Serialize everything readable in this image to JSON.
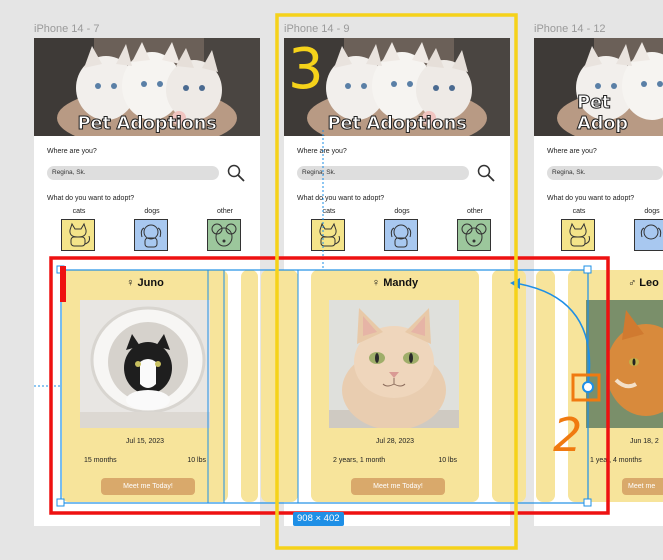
{
  "frames": [
    {
      "label": "iPhone 14 - 7"
    },
    {
      "label": "iPhone 14 - 9"
    },
    {
      "label": "iPhone 14 - 12"
    }
  ],
  "app": {
    "title": "Pet Adoptions",
    "title_short": "Pet Adop",
    "location_question": "Where are you?",
    "location_value": "Regina, Sk.",
    "adopt_question": "What do you want to adopt?",
    "categories": [
      "cats",
      "dogs",
      "other"
    ],
    "category_short": "dogs"
  },
  "cards": [
    {
      "name": "♀ Juno",
      "date": "Jul 15, 2023",
      "age": "15 months",
      "weight": "10 lbs",
      "button": "Meet me Today!"
    },
    {
      "name": "♀ Mandy",
      "date": "Jul 28, 2023",
      "age": "2 years, 1 month",
      "weight": "10 lbs",
      "button": "Meet me Today!"
    },
    {
      "name": "♂ Leo",
      "date": "Jun 18, 2",
      "age": "1 year, 4 months",
      "weight": "",
      "button": "Meet me"
    }
  ],
  "annotations": {
    "one": "1",
    "two": "2",
    "three": "3",
    "dimension_badge": "908 × 402"
  },
  "colors": {
    "card": "#f7e49b",
    "button": "#d9a96b",
    "cats_box": "#f4e48a",
    "dogs_box": "#a8c8f0",
    "other_box": "#9cc79c",
    "red_annotation": "#ee1111",
    "yellow_annotation": "#f5d21a",
    "orange_annotation": "#f07a10",
    "selection_blue": "#1e8fe6"
  }
}
